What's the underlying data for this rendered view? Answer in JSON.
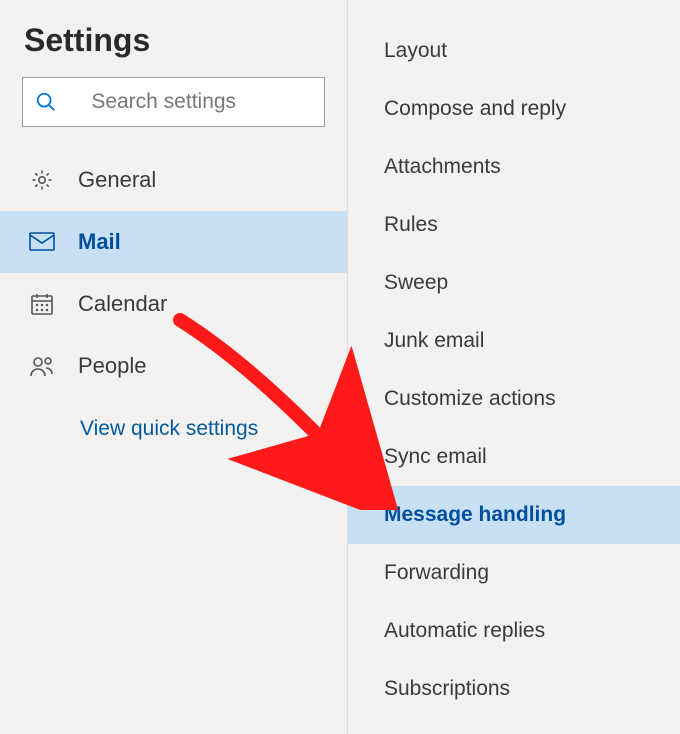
{
  "header": {
    "title": "Settings"
  },
  "search": {
    "placeholder": "Search settings"
  },
  "nav": {
    "items": [
      {
        "label": "General"
      },
      {
        "label": "Mail"
      },
      {
        "label": "Calendar"
      },
      {
        "label": "People"
      }
    ],
    "quickLink": "View quick settings"
  },
  "sub": {
    "items": [
      {
        "label": "Layout"
      },
      {
        "label": "Compose and reply"
      },
      {
        "label": "Attachments"
      },
      {
        "label": "Rules"
      },
      {
        "label": "Sweep"
      },
      {
        "label": "Junk email"
      },
      {
        "label": "Customize actions"
      },
      {
        "label": "Sync email"
      },
      {
        "label": "Message handling"
      },
      {
        "label": "Forwarding"
      },
      {
        "label": "Automatic replies"
      },
      {
        "label": "Subscriptions"
      }
    ]
  },
  "colors": {
    "accent": "#005a9e",
    "highlight": "#c7e0f4",
    "arrow": "#ff1a1a"
  }
}
